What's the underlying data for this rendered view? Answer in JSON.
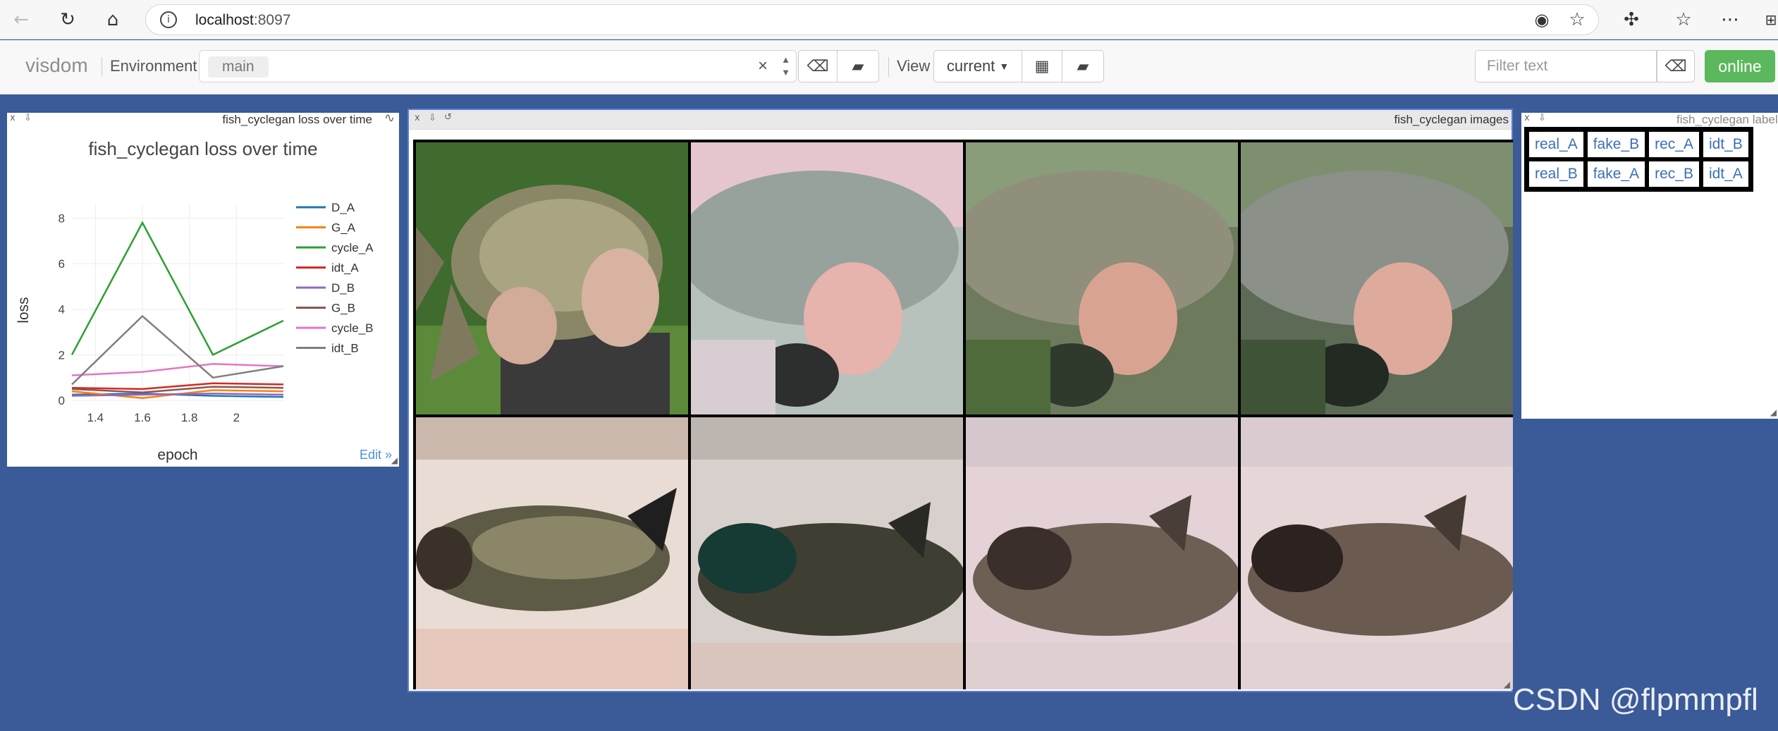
{
  "browser": {
    "url_host": "localhost",
    "url_port": ":8097"
  },
  "navbar": {
    "brand": "visdom",
    "environment_label": "Environment",
    "environment_tag": "main",
    "env_clear": "×",
    "view_label": "View",
    "view_select": "current",
    "filter_placeholder": "Filter text",
    "online_label": "online"
  },
  "panes": {
    "loss": {
      "header_title": "fish_cyclegan loss over time",
      "edit_link": "Edit »"
    },
    "images": {
      "header_title": "fish_cyclegan images"
    },
    "labels": {
      "header_title": "fish_cyclegan labels",
      "rows": [
        [
          "real_A",
          "fake_B",
          "rec_A",
          "idt_B"
        ],
        [
          "real_B",
          "fake_A",
          "rec_B",
          "idt_A"
        ]
      ]
    }
  },
  "watermark": "CSDN @flpmmpfl",
  "chart_data": {
    "type": "line",
    "title": "fish_cyclegan loss over time",
    "xlabel": "epoch",
    "ylabel": "loss",
    "x": [
      1.3,
      1.6,
      1.9,
      2.2
    ],
    "xlim": [
      1.3,
      2.2
    ],
    "ylim": [
      0,
      8.6
    ],
    "xticks": [
      1.4,
      1.6,
      1.8,
      2
    ],
    "yticks": [
      0,
      2,
      4,
      6,
      8
    ],
    "legend_position": "right",
    "series": [
      {
        "name": "D_A",
        "color": "#1f77b4",
        "values": [
          0.25,
          0.3,
          0.2,
          0.15
        ]
      },
      {
        "name": "G_A",
        "color": "#ff7f0e",
        "values": [
          0.4,
          0.1,
          0.45,
          0.4
        ]
      },
      {
        "name": "cycle_A",
        "color": "#2ca02c",
        "values": [
          2.0,
          7.8,
          2.0,
          3.5
        ]
      },
      {
        "name": "idt_A",
        "color": "#d62728",
        "values": [
          0.55,
          0.5,
          0.75,
          0.7
        ]
      },
      {
        "name": "D_B",
        "color": "#9467bd",
        "values": [
          0.2,
          0.25,
          0.3,
          0.25
        ]
      },
      {
        "name": "G_B",
        "color": "#8c564b",
        "values": [
          0.5,
          0.35,
          0.6,
          0.55
        ]
      },
      {
        "name": "cycle_B",
        "color": "#e377c2",
        "values": [
          1.1,
          1.25,
          1.6,
          1.5
        ]
      },
      {
        "name": "idt_B",
        "color": "#7f7f7f",
        "values": [
          0.7,
          3.7,
          1.0,
          1.5
        ]
      }
    ]
  }
}
